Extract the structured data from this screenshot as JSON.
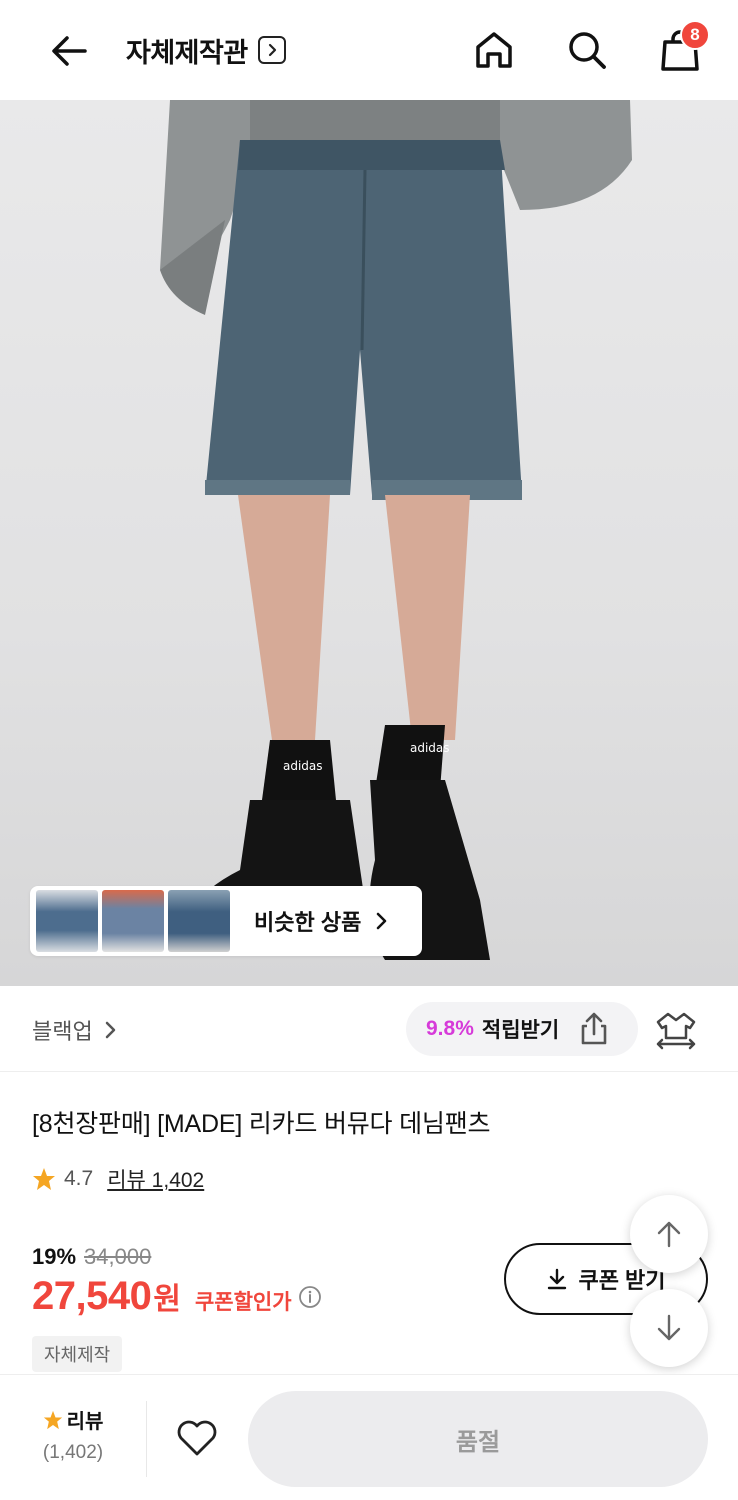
{
  "header": {
    "title": "자체제작관",
    "cart_count": "8",
    "icons": [
      "arrow-left-icon",
      "chevron-right-icon",
      "home-icon",
      "search-icon",
      "shopping-bag-icon"
    ]
  },
  "hero": {
    "similar_label": "비슷한 상품"
  },
  "brand_row": {
    "brand": "블랙업",
    "points_rate": "9.8%",
    "points_text": "적립받기"
  },
  "product": {
    "name": "[8천장판매] [MADE] 리카드 버뮤다 데님팬츠",
    "rating": "4.7",
    "review_link": "리뷰 1,402",
    "discount": "19%",
    "original_price": "34,000",
    "sale_price": "27,540",
    "currency": "원",
    "coupon_label": "쿠폰할인가",
    "tag": "자체제작",
    "coupon_button": "쿠폰 받기"
  },
  "bottom_bar": {
    "review_label": "리뷰",
    "review_count": "(1,402)",
    "soldout_label": "품절"
  },
  "colors": {
    "accent": "#f0463c",
    "points": "#d63ad9",
    "star": "#f5a623"
  }
}
